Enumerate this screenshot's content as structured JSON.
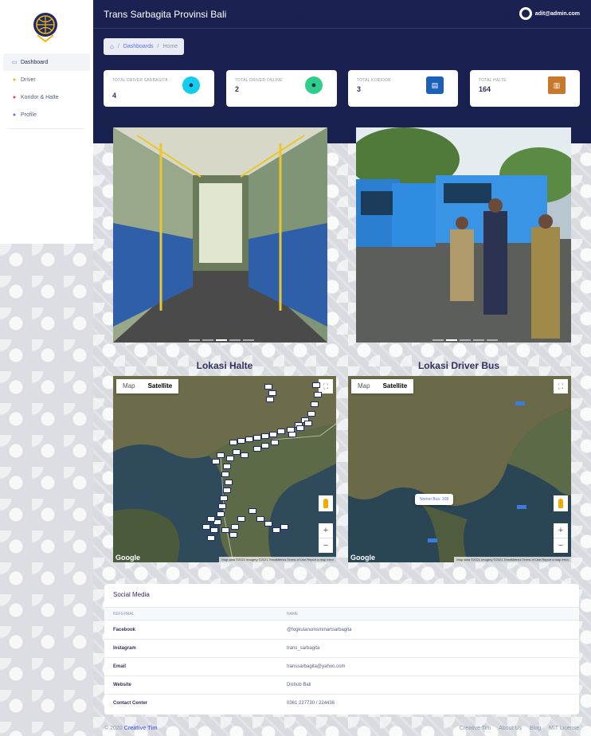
{
  "sidebar": {
    "items": [
      {
        "label": "Dashboard",
        "icon": "monitor-icon"
      },
      {
        "label": "Driver",
        "icon": "user-icon"
      },
      {
        "label": "Koridor & Halte",
        "icon": "pin-icon"
      },
      {
        "label": "Profile",
        "icon": "profile-icon"
      }
    ]
  },
  "header": {
    "title": "Trans Sarbagita Provinsi Bali",
    "user_email": "adit@admin.com"
  },
  "breadcrumb": {
    "items": [
      "Dashboards",
      "Home"
    ]
  },
  "stats": [
    {
      "label": "TOTAL DRIVER SARBAGITA",
      "value": "4",
      "icon": "driver-icon",
      "color": "#11cdef"
    },
    {
      "label": "TOTAL DRIVER ONLINE",
      "value": "2",
      "icon": "online-driver-icon",
      "color": "#2dce89"
    },
    {
      "label": "TOTAL KORIDOR",
      "value": "3",
      "icon": "bus-icon",
      "color": "#11cdef"
    },
    {
      "label": "TOTAL HALTE",
      "value": "164",
      "icon": "bus-stop-icon",
      "color": "#fb6340"
    }
  ],
  "maps": {
    "halte": {
      "title": "Lokasi Halte",
      "tab_map": "Map",
      "tab_satellite": "Satellite"
    },
    "driver": {
      "title": "Lokasi Driver Bus",
      "tab_map": "Map",
      "tab_satellite": "Satellite",
      "tooltip": "Nomor Bus: 108"
    },
    "google": "Google",
    "attribution": "Map data ©2021 Imagery ©2021 TerraMetrics   Terms of Use   Report a map error"
  },
  "social": {
    "title": "Social Media",
    "headers": [
      "REFERRAL",
      "NAME"
    ],
    "rows": [
      {
        "key": "Facebook",
        "value": "@fogkulanumsminartsarbagita"
      },
      {
        "key": "Instagram",
        "value": "trans_sarbagita"
      },
      {
        "key": "Email",
        "value": "transsarbagita@yahoo.com"
      },
      {
        "key": "Website",
        "value": "Dishub Bali"
      },
      {
        "key": "Contact Center",
        "value": "0361 227730 / 224436"
      }
    ]
  },
  "footer": {
    "copyright": "© 2020",
    "brand": "Creative Tim",
    "links": [
      "Creative Tim",
      "About Us",
      "Blog",
      "MIT License"
    ]
  }
}
